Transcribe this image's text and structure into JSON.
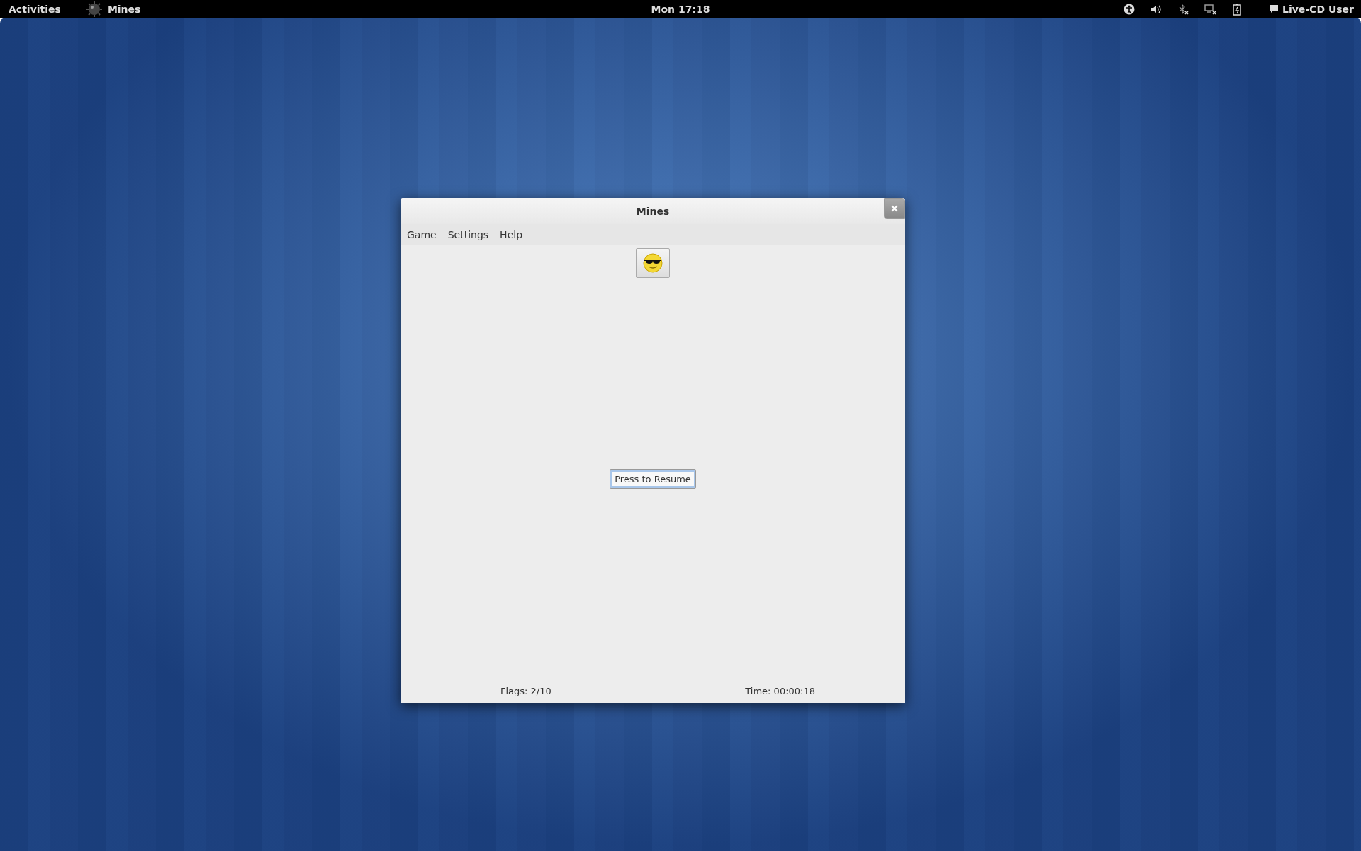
{
  "top_bar": {
    "activities": "Activities",
    "app_name": "Mines",
    "clock": "Mon 17:18",
    "user": "Live-CD User"
  },
  "window": {
    "title": "Mines"
  },
  "menu": [
    "Game",
    "Settings",
    "Help"
  ],
  "resume_button": "Press to Resume",
  "status_bar": {
    "flags": "Flags: 2/10",
    "time": "Time: 00:00:18"
  }
}
